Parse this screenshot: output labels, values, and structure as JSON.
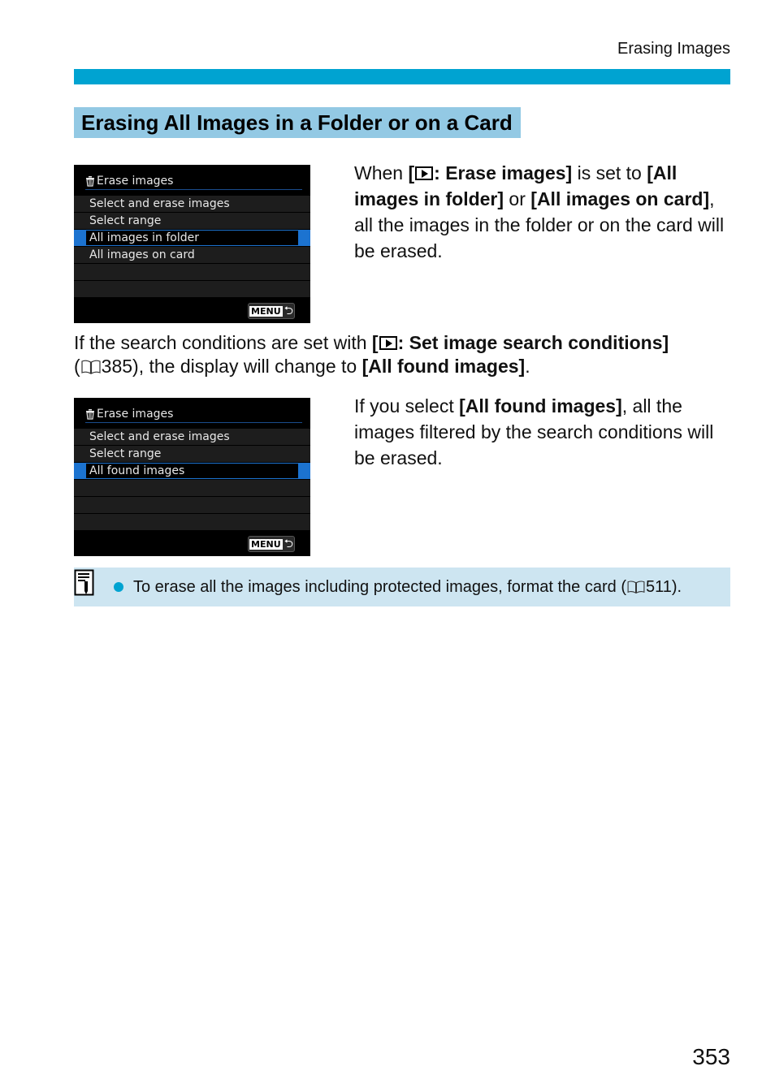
{
  "running_head": "Erasing Images",
  "colors": {
    "accent_bar": "#00a3d1",
    "section_bg": "#93c9e4",
    "note_bg": "#cde5f1",
    "selection": "#1c73d0"
  },
  "section_title": "Erasing All Images in a Folder or on a Card",
  "screen1": {
    "title_icon": "trash-icon",
    "title": "Erase images",
    "rows": [
      "Select and erase images",
      "Select range",
      "All images in folder",
      "All images on card",
      "",
      ""
    ],
    "selected_index": 2,
    "menu_label": "MENU",
    "back_icon": "return-arrow-icon"
  },
  "screen2": {
    "title_icon": "trash-icon",
    "title": "Erase images",
    "rows": [
      "Select and erase images",
      "Select range",
      "All found images",
      "",
      "",
      ""
    ],
    "selected_index": 2,
    "menu_label": "MENU",
    "back_icon": "return-arrow-icon"
  },
  "para1": {
    "t1": "When ",
    "b1": "[",
    "b2": ": Erase images]",
    "t2": " is set to ",
    "b3": "[All images in folder]",
    "t3": " or ",
    "b4": "[All images on card]",
    "t4": ", all the images in the folder or on the card will be erased."
  },
  "para2": {
    "t1": "If the search conditions are set with ",
    "b1": "[",
    "b2": ": Set image search conditions]",
    "t2": " (",
    "page_ref": "385",
    "t3": "), the display will change to ",
    "b3": "[All found images]",
    "t4": "."
  },
  "para3": {
    "t1": "If you select ",
    "b1": "[All found images]",
    "t2": ", all the images filtered by the search conditions will be erased."
  },
  "note": {
    "icon": "memo-pencil-icon",
    "text1": "To erase all the images including protected images, format the card (",
    "page_ref": "511",
    "text2": ")."
  },
  "page_number": "353"
}
